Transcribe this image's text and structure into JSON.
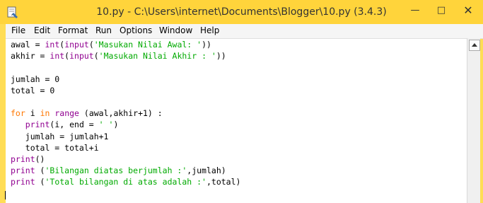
{
  "window": {
    "title": "10.py - C:\\Users\\internet\\Documents\\Blogger\\10.py (3.4.3)",
    "minimize_glyph": "—",
    "maximize_glyph": "□",
    "close_glyph": "✕"
  },
  "menu": [
    "File",
    "Edit",
    "Format",
    "Run",
    "Options",
    "Window",
    "Help"
  ],
  "code": [
    {
      "parts": [
        {
          "t": "awal = "
        },
        {
          "t": "int",
          "c": "bi"
        },
        {
          "t": "("
        },
        {
          "t": "input",
          "c": "bi"
        },
        {
          "t": "("
        },
        {
          "t": "'Masukan Nilai Awal: '",
          "c": "str"
        },
        {
          "t": "))"
        }
      ]
    },
    {
      "parts": [
        {
          "t": "akhir = "
        },
        {
          "t": "int",
          "c": "bi"
        },
        {
          "t": "("
        },
        {
          "t": "input",
          "c": "bi"
        },
        {
          "t": "("
        },
        {
          "t": "'Masukan Nilai Akhir : '",
          "c": "str"
        },
        {
          "t": "))"
        }
      ]
    },
    {
      "parts": [
        {
          "t": ""
        }
      ]
    },
    {
      "parts": [
        {
          "t": "jumlah = 0"
        }
      ]
    },
    {
      "parts": [
        {
          "t": "total = 0"
        }
      ]
    },
    {
      "parts": [
        {
          "t": ""
        }
      ]
    },
    {
      "parts": [
        {
          "t": "for",
          "c": "kw"
        },
        {
          "t": " i "
        },
        {
          "t": "in",
          "c": "kw"
        },
        {
          "t": " "
        },
        {
          "t": "range",
          "c": "bi"
        },
        {
          "t": " (awal,akhir+1) :"
        }
      ]
    },
    {
      "parts": [
        {
          "t": "   "
        },
        {
          "t": "print",
          "c": "bi"
        },
        {
          "t": "(i, end = "
        },
        {
          "t": "' '",
          "c": "str"
        },
        {
          "t": ")"
        }
      ]
    },
    {
      "parts": [
        {
          "t": "   jumlah = jumlah+1"
        }
      ]
    },
    {
      "parts": [
        {
          "t": "   total = total+i"
        }
      ]
    },
    {
      "parts": [
        {
          "t": "print",
          "c": "bi"
        },
        {
          "t": "()"
        }
      ]
    },
    {
      "parts": [
        {
          "t": "print",
          "c": "bi"
        },
        {
          "t": " ("
        },
        {
          "t": "'Bilangan diatas berjumlah :'",
          "c": "str"
        },
        {
          "t": ",jumlah)"
        }
      ]
    },
    {
      "parts": [
        {
          "t": "print",
          "c": "bi"
        },
        {
          "t": " ("
        },
        {
          "t": "'Total bilangan di atas adalah :'",
          "c": "str"
        },
        {
          "t": ",total)"
        }
      ]
    }
  ],
  "colors": {
    "titlebar": "#ffd43b",
    "keyword": "#ff7700",
    "builtin": "#900090",
    "string": "#00aa00"
  }
}
